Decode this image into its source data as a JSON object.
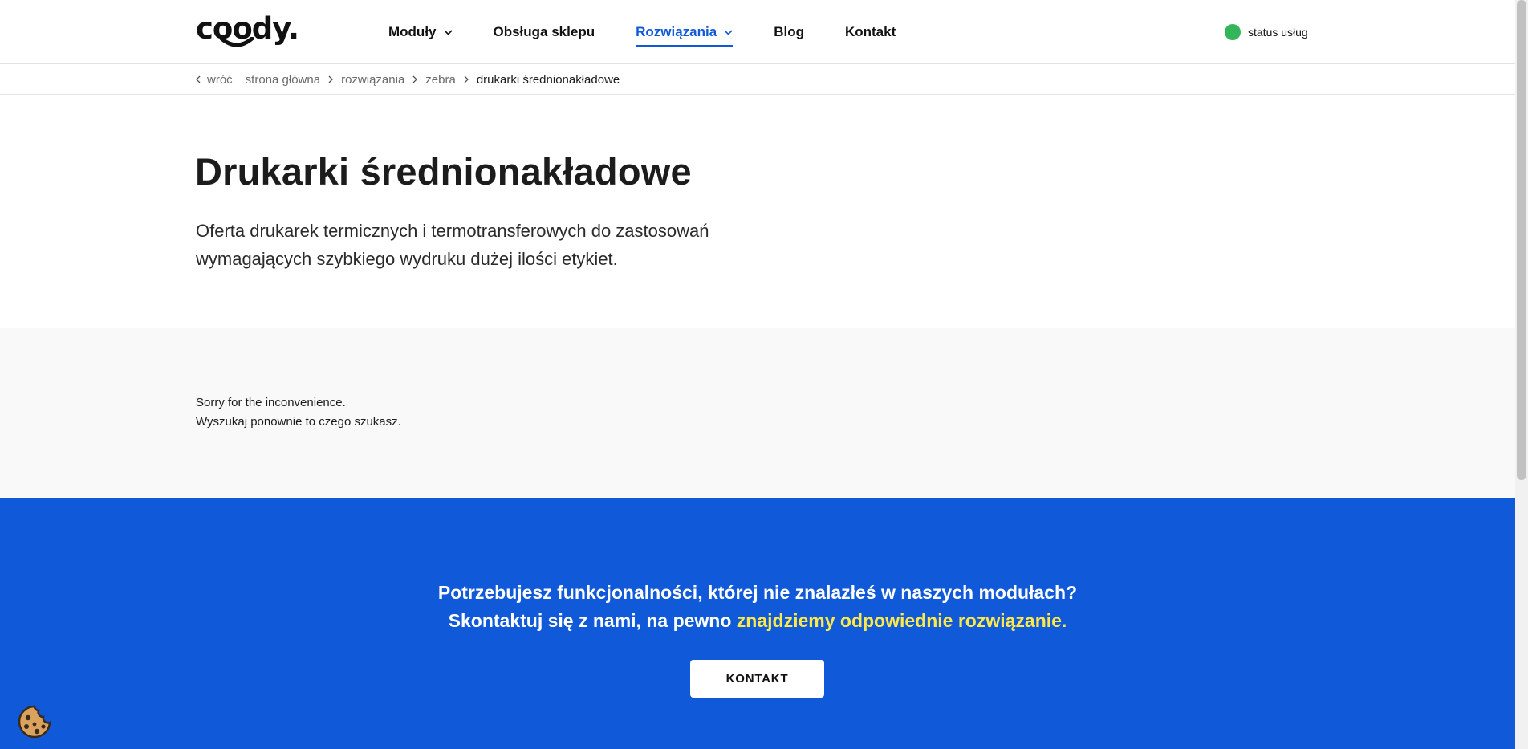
{
  "header": {
    "logo_text": "coody.",
    "nav": [
      {
        "label": "Moduły",
        "has_dropdown": true,
        "active": false
      },
      {
        "label": "Obsługa sklepu",
        "has_dropdown": false,
        "active": false
      },
      {
        "label": "Rozwiązania",
        "has_dropdown": true,
        "active": true
      },
      {
        "label": "Blog",
        "has_dropdown": false,
        "active": false
      },
      {
        "label": "Kontakt",
        "has_dropdown": false,
        "active": false
      }
    ],
    "status_label": "status usług",
    "status_color": "#33b55a"
  },
  "breadcrumb": {
    "back_label": "wróć",
    "items": [
      "strona główna",
      "rozwiązania",
      "zebra"
    ],
    "current": "drukarki średnionakładowe"
  },
  "hero": {
    "title": "Drukarki średnionakładowe",
    "description_line1": "Oferta drukarek termicznych i termotransferowych do zastosowań",
    "description_line2": "wymagających szybkiego wydruku dużej ilości etykiet."
  },
  "message": {
    "line1": "Sorry for the inconvenience.",
    "line2": "Wyszukaj ponownie to czego szukasz."
  },
  "cta": {
    "line1": "Potrzebujesz funkcjonalności, której nie znalazłeś w naszych modułach?",
    "line2_plain": "Skontaktuj się z nami, na pewno ",
    "line2_highlight": "znajdziemy odpowiednie rozwiązanie.",
    "button_label": "KONTAKT",
    "background": "#1059d9",
    "highlight_color": "#ffe94a"
  },
  "icons": {
    "cookie": "cookie-icon",
    "dropdown": "chevron-down-icon",
    "separator": "chevron-right-icon",
    "back": "chevron-left-icon"
  }
}
